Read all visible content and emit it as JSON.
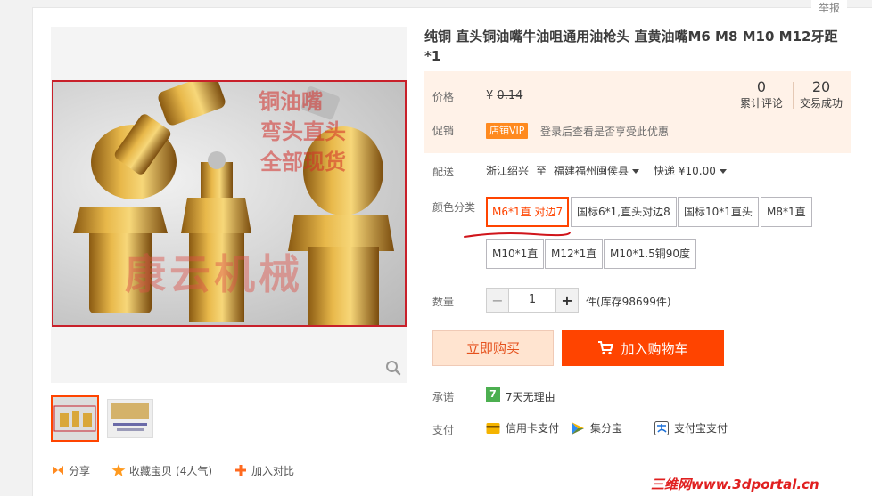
{
  "report_label": "举报",
  "title": "纯铜 直头铜油嘴牛油咀通用油枪头 直黄油嘴M6 M8 M10 M12牙距*1",
  "photo": {
    "overlay_text_lines": [
      "铜油嘴",
      "弯头直头",
      "全部现货"
    ],
    "watermark": "康云机械"
  },
  "price": {
    "label": "价格",
    "currency": "¥",
    "value": "0.14"
  },
  "stats": {
    "reviews_count": "0",
    "reviews_label": "累计评论",
    "sales_count": "20",
    "sales_label": "交易成功"
  },
  "promo": {
    "label": "促销",
    "badge": "店铺VIP",
    "text": "登录后查看是否享受此优惠"
  },
  "delivery": {
    "label": "配送",
    "from": "浙江绍兴",
    "to_word": "至",
    "destination": "福建福州闽侯县",
    "shipping": "快递 ¥10.00"
  },
  "sku": {
    "label": "颜色分类",
    "options": [
      "M6*1直 对边7",
      "国标6*1,直头对边8",
      "国标10*1直头",
      "M8*1直",
      "M10*1直",
      "M12*1直",
      "M10*1.5铜90度"
    ],
    "selected_index": 0
  },
  "quantity": {
    "label": "数量",
    "minus": "−",
    "value": "1",
    "plus": "+",
    "unit_stock": "件(库存98699件)"
  },
  "buttons": {
    "buy_now": "立即购买",
    "add_to_cart": "加入购物车"
  },
  "promise": {
    "label": "承诺",
    "icon_text": "7",
    "text": "7天无理由"
  },
  "payment": {
    "label": "支付",
    "methods": [
      "信用卡支付",
      "集分宝",
      "支付宝支付"
    ]
  },
  "bottom_actions": {
    "share": "分享",
    "favorite": "收藏宝贝",
    "favorite_count": "(4人气)",
    "compare": "加入对比"
  },
  "site_watermark": "三维网www.3dportal.cn",
  "colors": {
    "accent": "#ff4400",
    "price_bg": "#fff2e8",
    "selected_border": "#ff4400",
    "photo_border": "#c8202a"
  }
}
